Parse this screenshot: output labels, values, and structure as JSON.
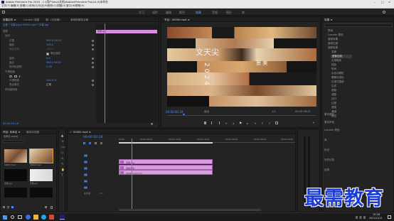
{
  "window": {
    "title": "Adobe Premiere Pro 2020 - C:\\用户\\dsvj\\文档\\Adobe\\Premiere Pro\\14.0\\未命名",
    "controls": [
      "–",
      "□",
      "×"
    ]
  },
  "menu": [
    "文件(F)",
    "编辑(E)",
    "剪辑(C)",
    "序列(S)",
    "标记(M)",
    "图形(G)",
    "视图(V)",
    "窗口(W)",
    "帮助(H)"
  ],
  "workspaces": {
    "items": [
      "学习",
      "组件",
      "编辑",
      "颜色",
      "效果",
      "音频",
      "图形",
      "库"
    ],
    "active_index": 4
  },
  "effect_controls": {
    "tabs": [
      "效果控件 ≡",
      "Lumetri 范围",
      "源：(无剪辑)",
      "音频剪辑混合器"
    ],
    "source_line": "主要 * 字幕.jpg ▾   00000.mp4 * 字幕.jpg",
    "clip_tag": "字幕.jpg",
    "section_video": "视频",
    "section_motion": "运动",
    "rows": [
      {
        "label": "位置",
        "value": "960.0   540.0"
      },
      {
        "label": "缩放",
        "value": "100.0"
      },
      {
        "label": "缩放宽度",
        "value": "100.0"
      },
      {
        "label": "等比缩放",
        "checkbox": true
      },
      {
        "label": "旋转",
        "value": "0.0"
      },
      {
        "label": "锚点",
        "value": "960.0   540.0"
      },
      {
        "label": "防闪烁滤镜",
        "value": "0.00"
      }
    ],
    "opacity_label": "不透明度",
    "mask_label": "不透明度",
    "opacity_value": "100.0 %",
    "blend_label": "混合模式",
    "blend_value": "正常",
    "time_remap_label": "时间重映射",
    "timecode": "00:00:00:18"
  },
  "program_monitor": {
    "title": "节目：00000.mp4 ≡",
    "timecode": "00:00:00:18",
    "fit": "适合",
    "quality": "1/2",
    "duration": "00:00:28:01",
    "overlay_chars_left": "文天尖",
    "overlay_digits": "2024",
    "overlay_chars_right": "景 美"
  },
  "project": {
    "tabs": [
      "项目: 未命名 ≡",
      "媒体浏览器"
    ],
    "path": "未命名.prproj",
    "items": [
      {
        "name": "00000.mp4",
        "duration": "0:00"
      },
      {
        "name": "00000.mp4",
        "duration": "0:00"
      },
      {
        "name": "字幕.jpg",
        "duration": "5:00"
      },
      {
        "name": "字幕.jpg",
        "duration": ""
      }
    ]
  },
  "timeline": {
    "title": "00000.mp4 ≡",
    "timecode": "00:00:00:18",
    "ruler": [
      "00:00",
      "00:00:05:00",
      "00:00:10:00",
      "00:00:15:00",
      "00:00:20:00",
      "00:00:25:00",
      "00:00:30:00"
    ],
    "tracks": [
      "V3",
      "V2",
      "V1",
      "A1",
      "A2",
      "A3",
      "主声道"
    ],
    "master_value": "0.0",
    "clips": [
      {
        "label": "字幕.jpg",
        "track": "V3"
      },
      {
        "label": "颜色遮罩",
        "track": "V2"
      },
      {
        "label": "00000.mp4 [V]",
        "track": "V1"
      }
    ]
  },
  "effects_panel": {
    "title": "效果 ≡",
    "tree": [
      "预设",
      "Lumetri 预设",
      "音频效果",
      "音频过渡",
      "视频效果",
      "变换",
      "图像控制",
      "实用程序",
      "扭曲",
      "时间",
      "杂色与颗粒",
      "模糊与锐化",
      "沉浸式视频",
      "生成",
      "视频",
      "调整",
      "过时",
      "过渡",
      "透视",
      "通道",
      "键控"
    ],
    "selected": "图像控制",
    "bottom_items": [
      "基本图形",
      "基本声音",
      "Lumetri 颜色",
      "库",
      "标记",
      "历史记录",
      "信息"
    ]
  },
  "watermark": {
    "text": "最需教育",
    "color": "#1a3bd6"
  },
  "taskbar": {
    "time": "15:26",
    "date": "2021/11/12",
    "icons": [
      "#3a6fd8",
      "#f2b13a",
      "#2aa0e8",
      "#dd4433",
      "#e24a33",
      "#7a54c8",
      "#44b04a",
      "#9bc1ff",
      "#5c2e91"
    ]
  }
}
